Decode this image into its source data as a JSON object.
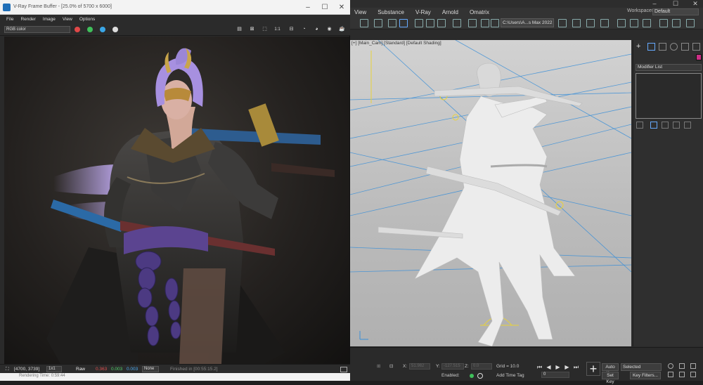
{
  "max": {
    "menu": [
      "View",
      "Substance",
      "V-Ray",
      "Arnold",
      "Omatrix"
    ],
    "window_controls": {
      "minimize": "–",
      "maximize": "☐",
      "close": "✕"
    },
    "workspace_label": "Workspaces:",
    "workspace_value": "Default",
    "project_path": "C:\\Users\\A...s Max 2022",
    "viewport_label": "[+] [Main_Cam] [Standard] [Default Shading]",
    "command_panel": {
      "modifier_list": "Modifier List",
      "color": "#cc2f86"
    },
    "bottom": {
      "x_label": "X:",
      "x_value": "51.982",
      "y_label": "Y:",
      "y_value": "-127.515",
      "z_label": "Z:",
      "z_value": "0.0",
      "grid": "Grid = 10.0",
      "enabled_label": "Enabled:",
      "add_time_tag": "Add Time Tag",
      "auto_key": "Auto Key",
      "selected": "Selected",
      "set_key": "Set Key",
      "key_filters": "Key Filters...",
      "frame": "0",
      "add_key_symbol": "+"
    }
  },
  "vfb": {
    "title": "V-Ray Frame Buffer - [25.0% of 5700 x 6000]",
    "window_controls": {
      "minimize": "–",
      "maximize": "☐",
      "close": "✕"
    },
    "menu": [
      "File",
      "Render",
      "Image",
      "View",
      "Options"
    ],
    "channel": "RGB color",
    "channel_colors": {
      "red": "#e04848",
      "green": "#3fbf5a",
      "blue": "#3aa6e6"
    },
    "toolbar_zoom": "1:1",
    "status": {
      "coords": "[4700, 3739]",
      "ratio": "1x1",
      "raw_label": "Raw",
      "r": "0.363",
      "g": "0.003",
      "b": "0.003",
      "mode": "None",
      "finished": "Finished in [00:55:15.2]"
    },
    "render_time": "Rendering Time: 0:59:44"
  }
}
